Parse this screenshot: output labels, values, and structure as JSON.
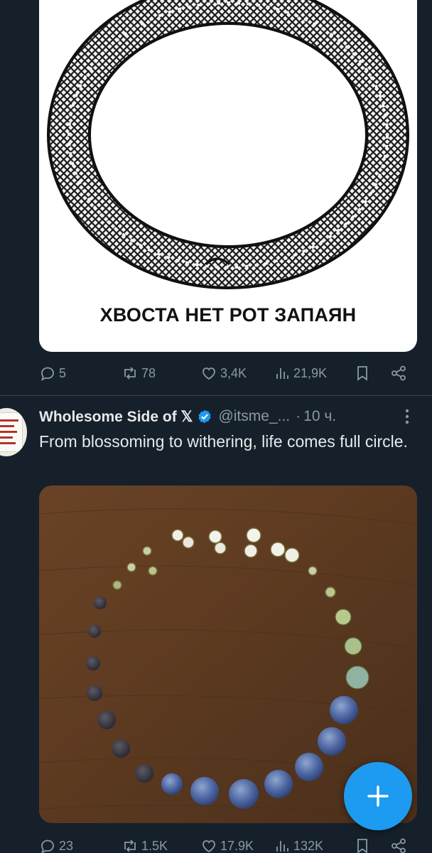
{
  "tweet1": {
    "image_caption": "ХВОСТА НЕТ РОТ ЗАПАЯН",
    "replies": "5",
    "retweets": "78",
    "likes": "3,4K",
    "views": "21,9K"
  },
  "tweet2": {
    "author_name": "Wholesome Side of 𝕏",
    "handle": "@itsme_...",
    "separator": "·",
    "time": "10 ч.",
    "text": "From blossoming to withering, life comes full circle.",
    "replies": "23",
    "retweets": "1.5K",
    "likes": "17.9K",
    "views": "132K"
  },
  "colors": {
    "background": "#15202b",
    "accent": "#1d9bf0",
    "muted": "#8b98a5",
    "text": "#e7e9ea"
  },
  "icons": [
    "reply-icon",
    "retweet-icon",
    "like-icon",
    "views-icon",
    "bookmark-icon",
    "share-icon",
    "verified-badge-icon",
    "more-icon",
    "compose-plus-icon"
  ]
}
